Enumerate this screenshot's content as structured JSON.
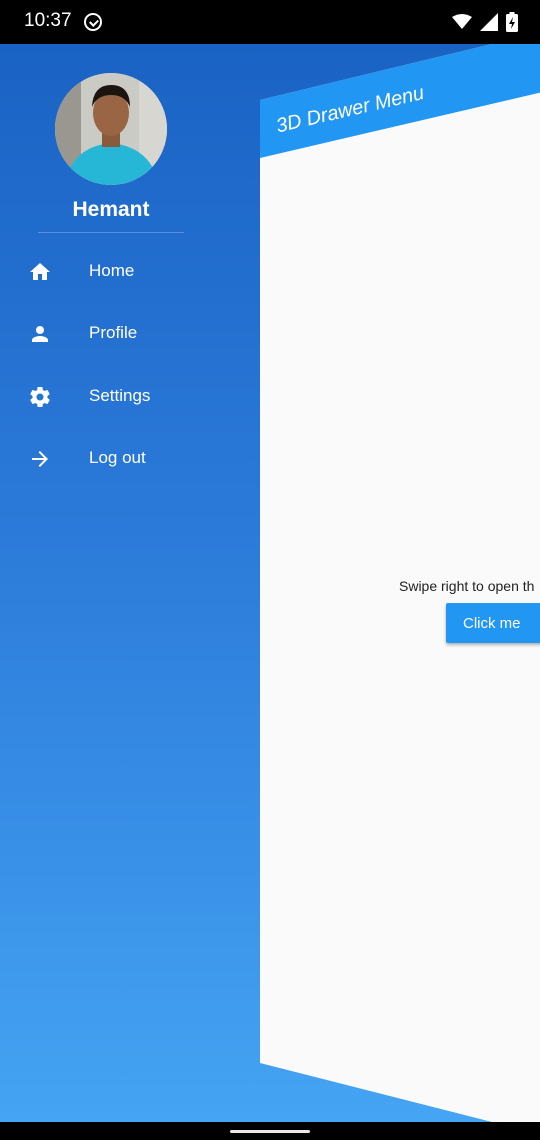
{
  "status_bar": {
    "time": "10:37",
    "icons": [
      "sync-icon",
      "wifi-icon",
      "cellular-signal-icon",
      "battery-charging-icon"
    ]
  },
  "drawer": {
    "user_name": "Hemant",
    "avatar_description": "profile-photo",
    "items": [
      {
        "label": "Home",
        "icon": "home-icon"
      },
      {
        "label": "Profile",
        "icon": "person-icon"
      },
      {
        "label": "Settings",
        "icon": "gear-icon"
      },
      {
        "label": "Log out",
        "icon": "arrow-right-icon"
      }
    ],
    "gradient_colors": [
      "#1a63c4",
      "#45a4f3"
    ]
  },
  "main": {
    "app_bar_title": "3D Drawer Menu",
    "helper_text": "Swipe right to open th",
    "button_label": "Click me",
    "accent_color": "#2196f3"
  }
}
